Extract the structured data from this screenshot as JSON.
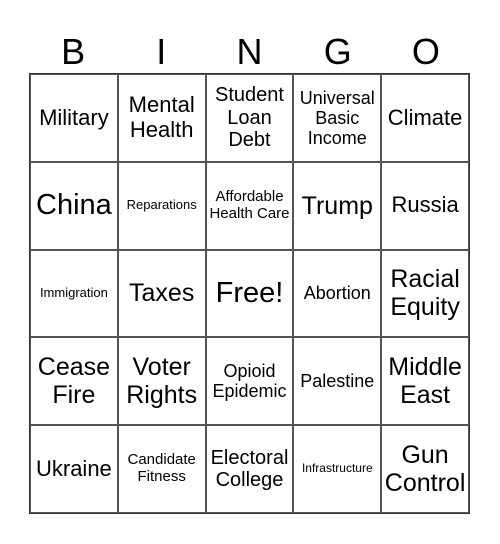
{
  "header": {
    "letters": [
      "B",
      "I",
      "N",
      "G",
      "O"
    ]
  },
  "cells": [
    [
      "Military",
      "Mental Health",
      "Student Loan Debt",
      "Universal Basic Income",
      "Climate"
    ],
    [
      "China",
      "Reparations",
      "Affordable Health Care",
      "Trump",
      "Russia"
    ],
    [
      "Immigration",
      "Taxes",
      "Free!",
      "Abortion",
      "Racial Equity"
    ],
    [
      "Cease Fire",
      "Voter Rights",
      "Opioid Epidemic",
      "Palestine",
      "Middle East"
    ],
    [
      "Ukraine",
      "Candidate Fitness",
      "Electoral College",
      "Infrastructure",
      "Gun Control"
    ]
  ]
}
